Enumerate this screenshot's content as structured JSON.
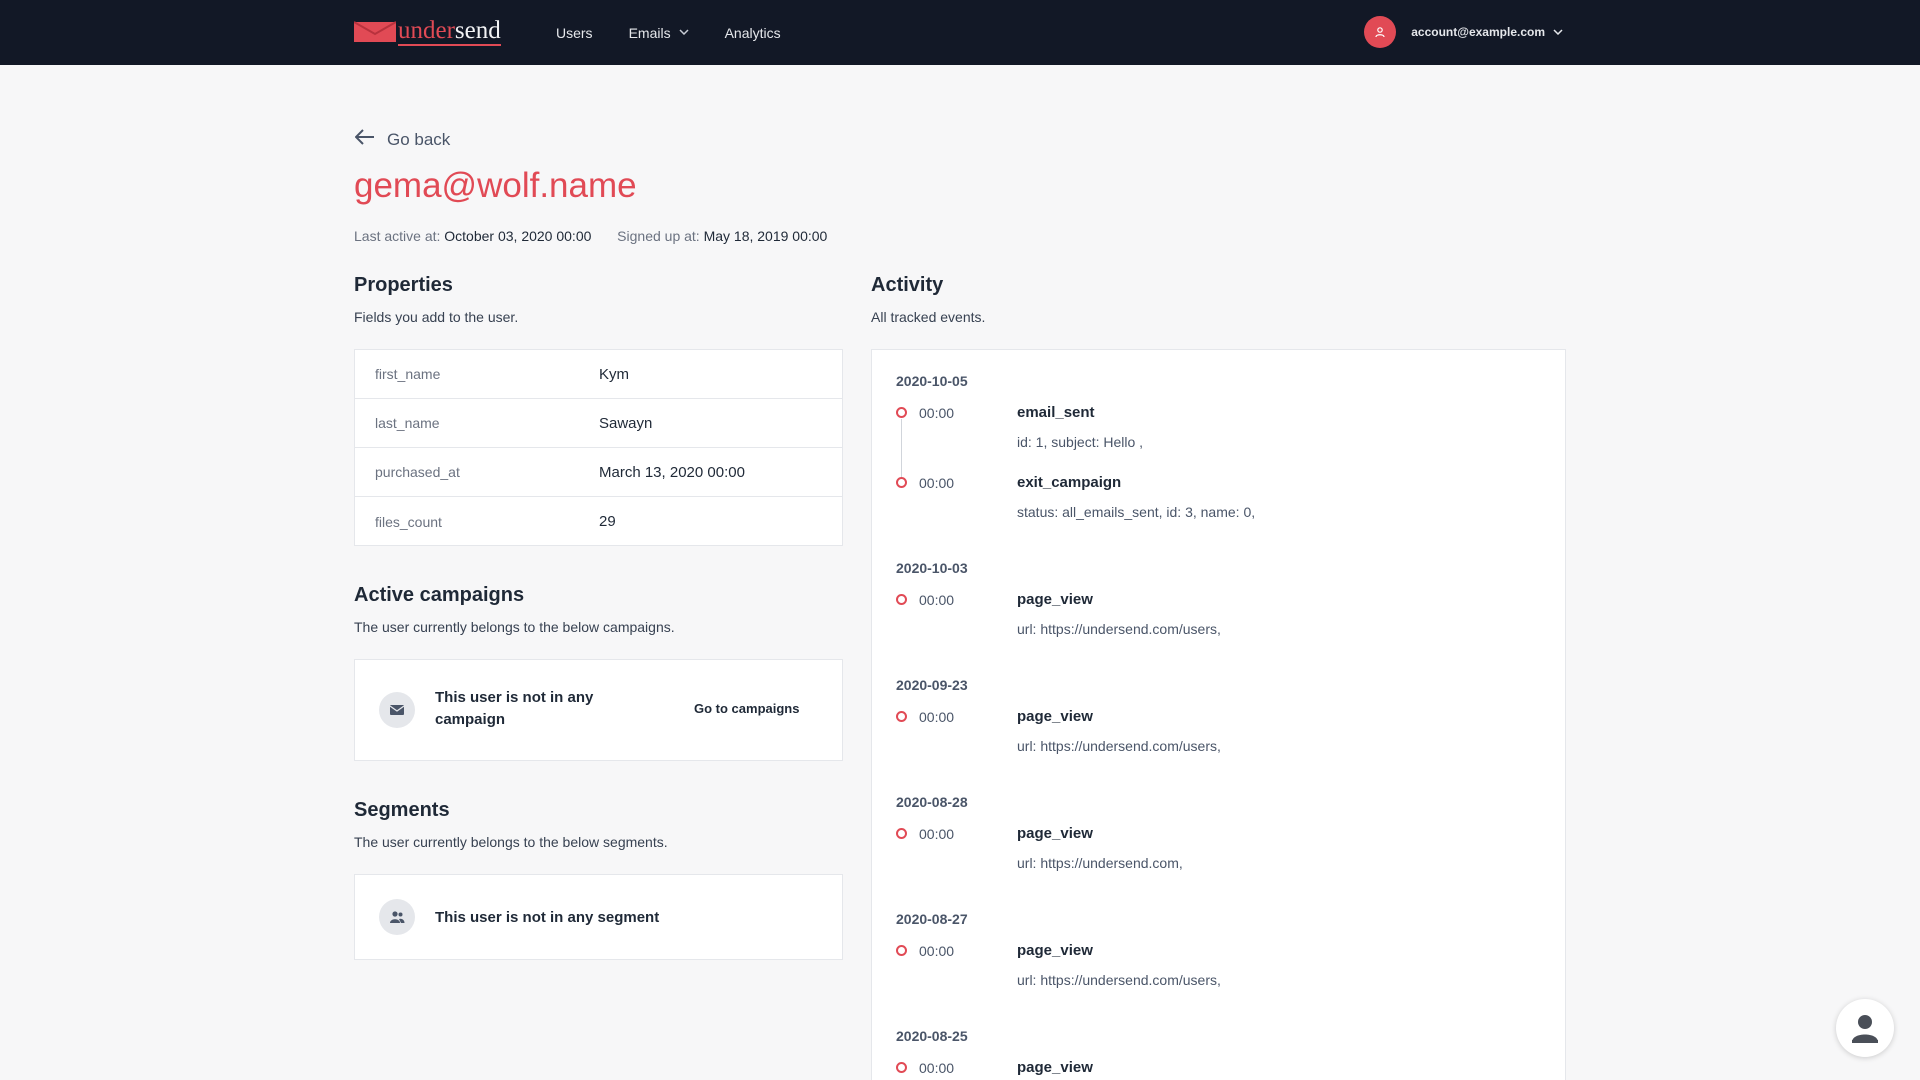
{
  "nav": {
    "brand_part1": "under",
    "brand_part2": "send",
    "links": [
      {
        "label": "Users"
      },
      {
        "label": "Emails",
        "has_dropdown": true
      },
      {
        "label": "Analytics"
      }
    ],
    "account_email": "account@example.com"
  },
  "header": {
    "go_back": "Go back",
    "title": "gema@wolf.name",
    "last_active_label": "Last active at:",
    "last_active_value": "October 03, 2020 00:00",
    "signed_up_label": "Signed up at:",
    "signed_up_value": "May 18, 2019 00:00"
  },
  "properties": {
    "title": "Properties",
    "subtitle": "Fields you add to the user.",
    "rows": [
      {
        "key": "first_name",
        "value": "Kym"
      },
      {
        "key": "last_name",
        "value": "Sawayn"
      },
      {
        "key": "purchased_at",
        "value": "March 13, 2020 00:00"
      },
      {
        "key": "files_count",
        "value": "29"
      }
    ]
  },
  "campaigns": {
    "title": "Active campaigns",
    "subtitle": "The user currently belongs to the below campaigns.",
    "empty_line1": "This user is not in any",
    "empty_line2": "campaign",
    "link": "Go to campaigns"
  },
  "segments": {
    "title": "Segments",
    "subtitle": "The user currently belongs to the below segments.",
    "empty": "This user is not in any segment"
  },
  "activity": {
    "title": "Activity",
    "subtitle": "All tracked events.",
    "groups": [
      {
        "date": "2020-10-05",
        "events": [
          {
            "time": "00:00",
            "name": "email_sent",
            "detail": "id: 1, subject: Hello ,"
          },
          {
            "time": "00:00",
            "name": "exit_campaign",
            "detail": "status: all_emails_sent, id: 3, name: 0,"
          }
        ]
      },
      {
        "date": "2020-10-03",
        "events": [
          {
            "time": "00:00",
            "name": "page_view",
            "detail": "url: https://undersend.com/users,"
          }
        ]
      },
      {
        "date": "2020-09-23",
        "events": [
          {
            "time": "00:00",
            "name": "page_view",
            "detail": "url: https://undersend.com/users,"
          }
        ]
      },
      {
        "date": "2020-08-28",
        "events": [
          {
            "time": "00:00",
            "name": "page_view",
            "detail": "url: https://undersend.com,"
          }
        ]
      },
      {
        "date": "2020-08-27",
        "events": [
          {
            "time": "00:00",
            "name": "page_view",
            "detail": "url: https://undersend.com/users,"
          }
        ]
      },
      {
        "date": "2020-08-25",
        "events": [
          {
            "time": "00:00",
            "name": "page_view",
            "detail": ""
          }
        ]
      }
    ]
  },
  "colors": {
    "navbar": "#121826",
    "accent": "#e14a55",
    "background": "#f7f7f8"
  },
  "icons": {
    "brand": "envelope-logo-icon",
    "dropdown": "chevron-down-icon",
    "back": "arrow-left-icon",
    "campaign": "mail-icon",
    "segment": "users-icon",
    "help": "person-icon"
  }
}
